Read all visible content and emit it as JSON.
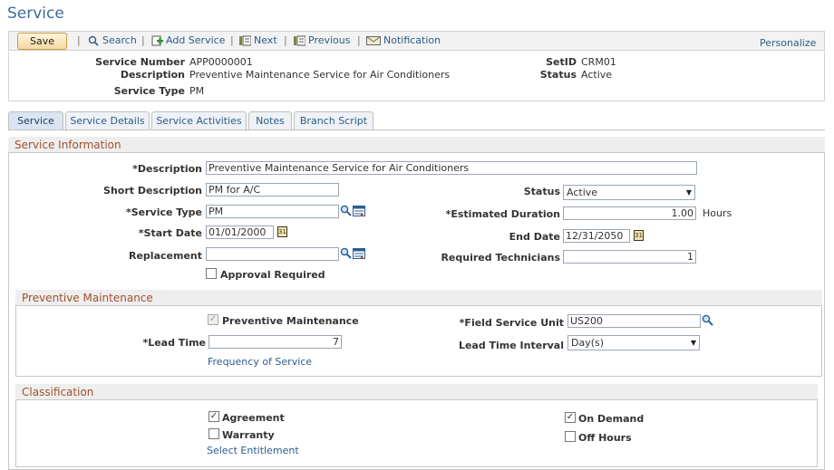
{
  "page": {
    "title": "Service"
  },
  "toolbar": {
    "save": "Save",
    "search": "Search",
    "add_service": "Add Service",
    "next": "Next",
    "previous": "Previous",
    "notification": "Notification",
    "personalize": "Personalize"
  },
  "keys": {
    "service_number_label": "Service Number",
    "service_number": "APP0000001",
    "description_label": "Description",
    "description": "Preventive Maintenance Service for Air Conditioners",
    "service_type_label": "Service Type",
    "service_type": "PM",
    "setid_label": "SetID",
    "setid": "CRM01",
    "status_label": "Status",
    "status": "Active"
  },
  "tabs": [
    {
      "label": "Service",
      "active": true
    },
    {
      "label": "Service Details"
    },
    {
      "label": "Service Activities"
    },
    {
      "label": "Notes"
    },
    {
      "label": "Branch Script"
    }
  ],
  "service_info": {
    "header": "Service Information",
    "description_label": "*Description",
    "description": "Preventive Maintenance Service for Air Conditioners",
    "short_description_label": "Short Description",
    "short_description": "PM for A/C",
    "status_label": "Status",
    "status": "Active",
    "service_type_label": "*Service Type",
    "service_type": "PM",
    "estimated_duration_label": "*Estimated Duration",
    "estimated_duration": "1.00",
    "duration_unit": "Hours",
    "start_date_label": "*Start Date",
    "start_date": "01/01/2000",
    "end_date_label": "End Date",
    "end_date": "12/31/2050",
    "replacement_label": "Replacement",
    "replacement": "",
    "required_technicians_label": "Required Technicians",
    "required_technicians": "1",
    "approval_required_label": "Approval Required"
  },
  "preventive": {
    "header": "Preventive Maintenance",
    "pm_label": "Preventive Maintenance",
    "field_service_unit_label": "*Field Service Unit",
    "field_service_unit": "US200",
    "lead_time_label": "*Lead Time",
    "lead_time": "7",
    "lead_time_interval_label": "Lead Time Interval",
    "lead_time_interval": "Day(s)",
    "frequency_link": "Frequency of Service"
  },
  "classification": {
    "header": "Classification",
    "agreement_label": "Agreement",
    "warranty_label": "Warranty",
    "on_demand_label": "On Demand",
    "off_hours_label": "Off Hours",
    "select_entitlement": "Select Entitlement"
  },
  "icons": {
    "check": "✓"
  }
}
